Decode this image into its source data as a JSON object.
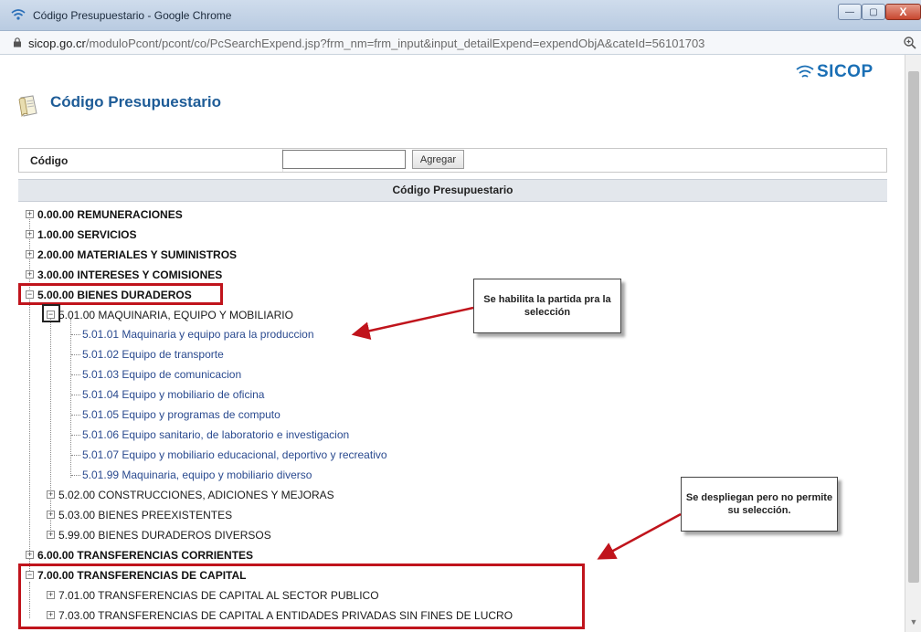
{
  "window": {
    "title": "Código Presupuestario - Google Chrome",
    "min_label": "—",
    "max_label": "▢",
    "close_label": "X"
  },
  "address": {
    "host": "sicop.go.cr",
    "path": "/moduloPcont/pcont/co/PcSearchExpend.jsp?frm_nm=frm_input&input_detailExpend=expendObjA&cateId=56101703"
  },
  "brand": {
    "logo_text": "SICOP"
  },
  "page": {
    "title": "Código Presupuestario"
  },
  "search": {
    "label": "Código",
    "value": "",
    "add_label": "Agregar"
  },
  "tree_header": "Código Presupuestario",
  "tree": {
    "root_items": [
      {
        "label": "0.00.00 REMUNERACIONES"
      },
      {
        "label": "1.00.00 SERVICIOS"
      },
      {
        "label": "2.00.00 MATERIALES Y SUMINISTROS"
      },
      {
        "label": "3.00.00 INTERESES Y COMISIONES"
      },
      {
        "label": "5.00.00 BIENES DURADEROS"
      },
      {
        "label": "6.00.00 TRANSFERENCIAS CORRIENTES"
      },
      {
        "label": "7.00.00 TRANSFERENCIAS DE CAPITAL"
      }
    ],
    "b5_children": [
      {
        "label": "5.01.00 MAQUINARIA, EQUIPO Y MOBILIARIO"
      },
      {
        "label": "5.02.00 CONSTRUCCIONES, ADICIONES Y MEJORAS"
      },
      {
        "label": "5.03.00 BIENES PREEXISTENTES"
      },
      {
        "label": "5.99.00 BIENES DURADEROS DIVERSOS"
      }
    ],
    "b501_leaves": [
      {
        "label": "5.01.01 Maquinaria y equipo para la produccion"
      },
      {
        "label": "5.01.02 Equipo de transporte"
      },
      {
        "label": "5.01.03 Equipo de comunicacion"
      },
      {
        "label": "5.01.04 Equipo y mobiliario de oficina"
      },
      {
        "label": "5.01.05 Equipo y programas de computo"
      },
      {
        "label": "5.01.06 Equipo sanitario, de laboratorio e investigacion"
      },
      {
        "label": "5.01.07 Equipo y mobiliario educacional, deportivo y recreativo"
      },
      {
        "label": "5.01.99 Maquinaria, equipo y mobiliario diverso"
      }
    ],
    "b7_children": [
      {
        "label": "7.01.00 TRANSFERENCIAS DE CAPITAL AL SECTOR PUBLICO"
      },
      {
        "label": "7.03.00 TRANSFERENCIAS DE CAPITAL A ENTIDADES PRIVADAS SIN FINES DE LUCRO"
      }
    ]
  },
  "annotations": {
    "callout_1": "Se habilita la partida pra la selección",
    "callout_2": "Se despliegan pero no permite su selección.",
    "highlight_color": "#c0141c"
  },
  "icons": {
    "wifi": "wifi-icon",
    "lock": "lock-icon",
    "zoom": "zoom-icon",
    "doc": "document-icon"
  }
}
